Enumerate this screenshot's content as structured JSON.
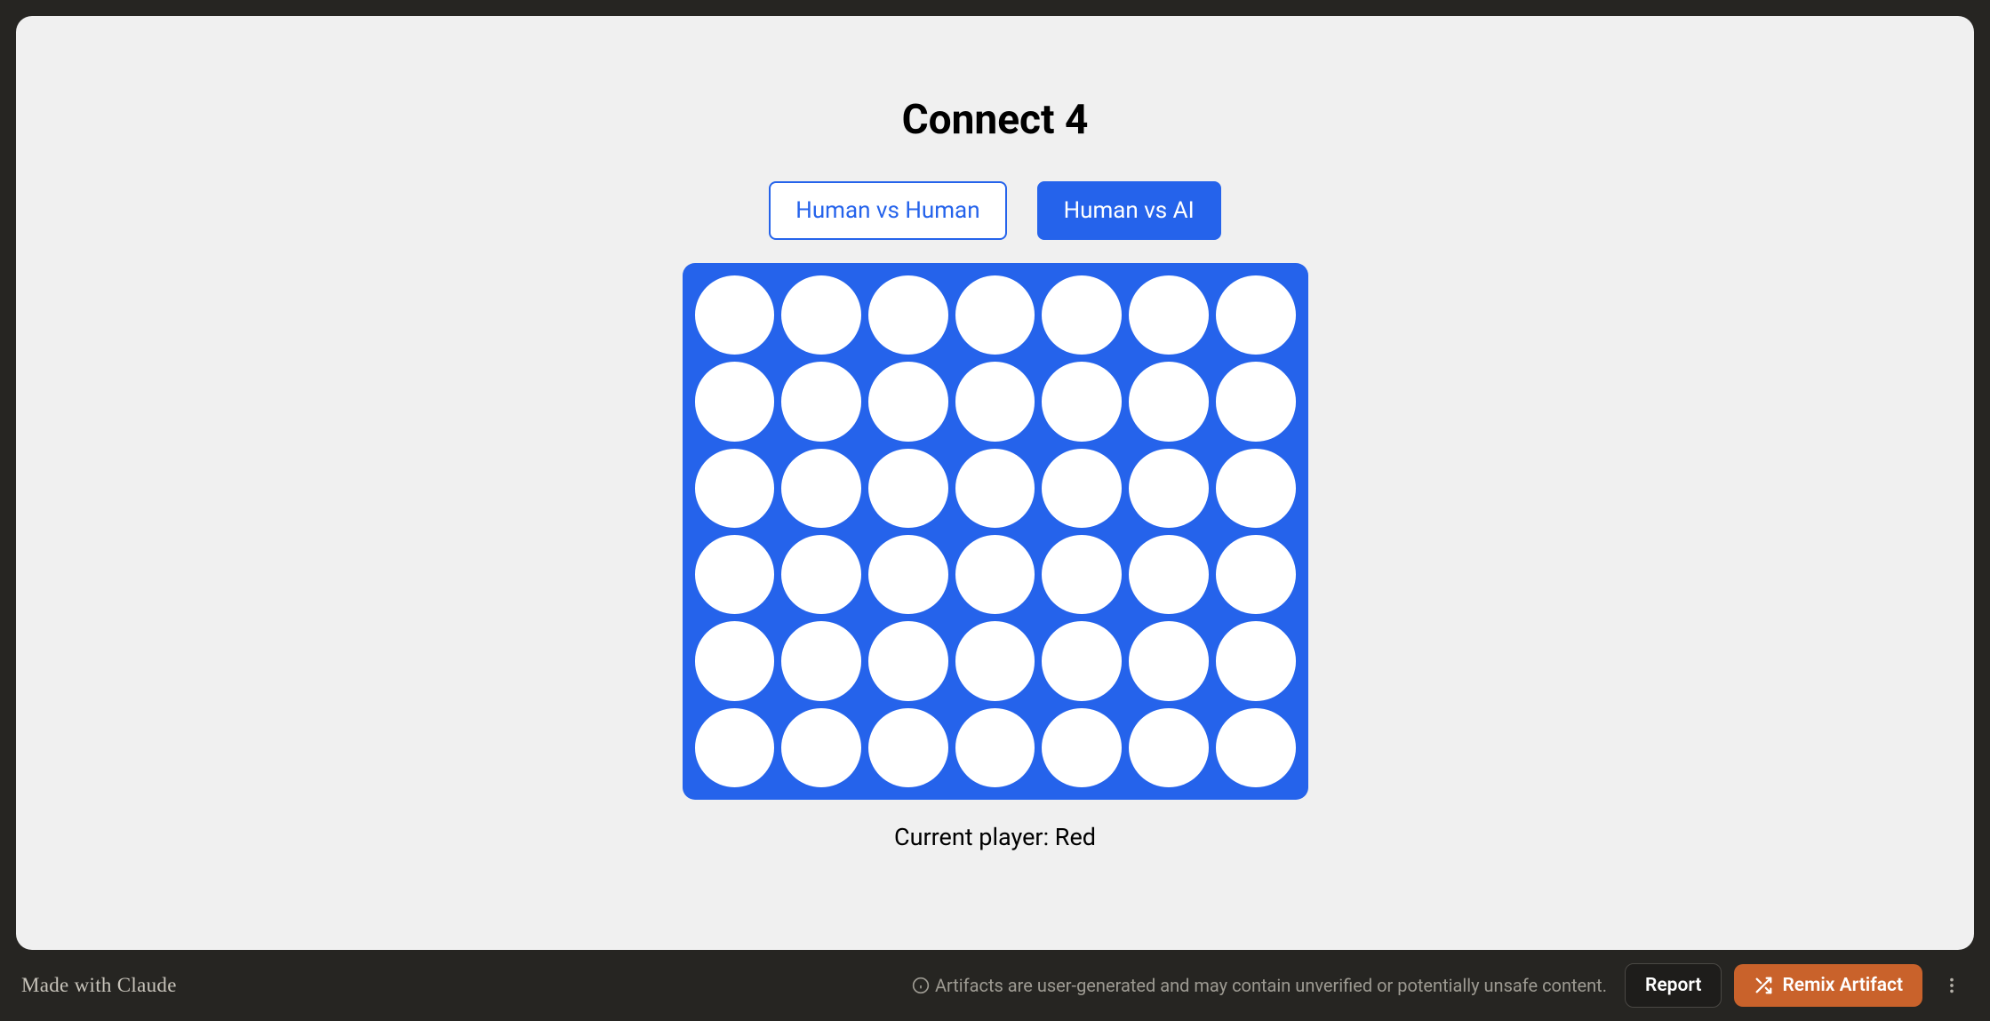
{
  "game": {
    "title": "Connect 4",
    "modes": [
      {
        "label": "Human vs Human",
        "active": false
      },
      {
        "label": "Human vs AI",
        "active": true
      }
    ],
    "board": {
      "rows": 6,
      "cols": 7,
      "cells": [
        [
          "empty",
          "empty",
          "empty",
          "empty",
          "empty",
          "empty",
          "empty"
        ],
        [
          "empty",
          "empty",
          "empty",
          "empty",
          "empty",
          "empty",
          "empty"
        ],
        [
          "empty",
          "empty",
          "empty",
          "empty",
          "empty",
          "empty",
          "empty"
        ],
        [
          "empty",
          "empty",
          "empty",
          "empty",
          "empty",
          "empty",
          "empty"
        ],
        [
          "empty",
          "empty",
          "empty",
          "empty",
          "empty",
          "empty",
          "empty"
        ],
        [
          "empty",
          "empty",
          "empty",
          "empty",
          "empty",
          "empty",
          "empty"
        ]
      ]
    },
    "status": "Current player: Red"
  },
  "footer": {
    "made_with": "Made with Claude",
    "disclaimer": "Artifacts are user-generated and may contain unverified or potentially unsafe content.",
    "report_label": "Report",
    "remix_label": "Remix Artifact"
  },
  "colors": {
    "board_bg": "#2563eb",
    "cell_empty": "#ffffff",
    "accent": "#c9622b",
    "frame_bg": "#f0f0f0",
    "page_bg": "#262522"
  }
}
